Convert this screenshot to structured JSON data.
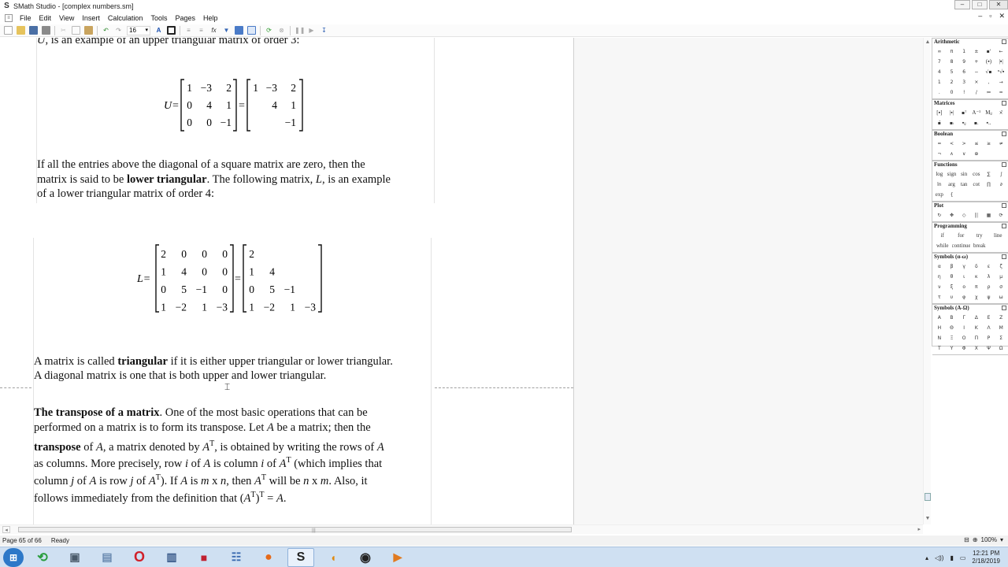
{
  "window": {
    "title": "SMath Studio - [complex numbers.sm]",
    "controls": {
      "minimize": "–",
      "maximize": "□",
      "close": "✕"
    },
    "mdi_controls": {
      "minimize": "–",
      "restore": "▫",
      "close": "✕"
    }
  },
  "menu": [
    "File",
    "Edit",
    "View",
    "Insert",
    "Calculation",
    "Tools",
    "Pages",
    "Help"
  ],
  "toolbar": {
    "font_size": "16"
  },
  "document": {
    "intro_fragment": "is an example of an upper triangular matrix of order 3:",
    "intro_var": "U",
    "upper_label": "U=",
    "upper_full": [
      [
        "1",
        "−3",
        "2"
      ],
      [
        "0",
        "4",
        "1"
      ],
      [
        "0",
        "0",
        "−1"
      ]
    ],
    "upper_short": [
      [
        "1",
        "−3",
        "2"
      ],
      [
        "",
        "4",
        "1"
      ],
      [
        "",
        "",
        "−1"
      ]
    ],
    "para_lower_1a": "If all the entries above the diagonal of a square matrix are zero, then the",
    "para_lower_2a": "matrix is said to be ",
    "para_lower_2b": "lower triangular",
    "para_lower_2c": ". The following matrix, ",
    "para_lower_2d": "L",
    "para_lower_2e": ", is an example",
    "para_lower_3": "of a lower triangular matrix of order 4:",
    "lower_label": "L=",
    "lower_full": [
      [
        "2",
        "0",
        "0",
        "0"
      ],
      [
        "1",
        "4",
        "0",
        "0"
      ],
      [
        "0",
        "5",
        "−1",
        "0"
      ],
      [
        "1",
        "−2",
        "1",
        "−3"
      ]
    ],
    "lower_short": [
      [
        "2",
        "",
        "",
        ""
      ],
      [
        "1",
        "4",
        "",
        ""
      ],
      [
        "0",
        "5",
        "−1",
        ""
      ],
      [
        "1",
        "−2",
        "1",
        "−3"
      ]
    ],
    "tri_1a": "A matrix is called ",
    "tri_1b": "triangular",
    "tri_1c": " if it is either upper triangular or lower triangular.",
    "tri_2": "A diagonal matrix is one that is both upper and lower triangular.",
    "t1a": "The transpose of a matrix",
    "t1b": ". One of the most basic operations that can be",
    "t2a": "performed on a matrix is to form its transpose. Let ",
    "t2b": "A",
    "t2c": " be a matrix; then the",
    "t3a": "transpose",
    "t3b": " of ",
    "t3c": "A",
    "t3d": ", a matrix denoted by ",
    "t3e": "A",
    "t3sup": "T",
    "t3f": ", is obtained by writing the rows of ",
    "t3g": "A",
    "t4a": "as columns. More precisely, row ",
    "t4b": "i",
    "t4c": " of ",
    "t4d": "A",
    "t4e": " is column ",
    "t4f": "i",
    "t4g": " of ",
    "t4h": "A",
    "t4sup": "T",
    "t4i": " (which implies that",
    "t5a": "column ",
    "t5b": "j",
    "t5c": " of ",
    "t5d": "A",
    "t5e": " is row ",
    "t5f": "j",
    "t5g": " of ",
    "t5h": "A",
    "t5sup": "T",
    "t5i": "). If ",
    "t5j": "A",
    "t5k": " is ",
    "t5l": "m",
    "t5m": " x ",
    "t5n": "n",
    "t5o": ", then ",
    "t5p": "A",
    "t5sup2": "T",
    "t5q": " will be ",
    "t5r": "n",
    "t5s": " x ",
    "t5t": "m",
    "t5u": ". Also, it",
    "t6a": "follows immediately from the definition that (",
    "t6b": "A",
    "t6sup": "T",
    "t6c": ")",
    "t6sup2": "T",
    "t6d": " = ",
    "t6e": "A",
    "t6f": "."
  },
  "panels": [
    {
      "title": "Arithmetic",
      "cols": 6,
      "items": [
        "∞",
        "π",
        "1",
        "±",
        "▪'",
        "←",
        "7",
        "8",
        "9",
        "+",
        "(▪)",
        "|▪|",
        "4",
        "5",
        "6",
        "−",
        "√▪",
        "ⁿ√▪",
        "1",
        "2",
        "3",
        "×",
        ",",
        "→",
        ".",
        "0",
        "!",
        "/",
        "≔",
        "="
      ]
    },
    {
      "title": "Matrices",
      "cols": 6,
      "items": [
        "[▪]",
        "|▪|",
        "▪ᵀ",
        "A⁻¹",
        "Mᵢⱼ",
        "×̄",
        "▪̄",
        "▪ᵢ",
        "▪ᵢⱼ",
        "▪.",
        "▪..",
        ""
      ]
    },
    {
      "title": "Boolean",
      "cols": 6,
      "items": [
        "=",
        "<",
        ">",
        "≤",
        "≥",
        "≠",
        "¬",
        "∧",
        "∨",
        "⊕",
        "",
        ""
      ]
    },
    {
      "title": "Functions",
      "cols": 6,
      "items": [
        "log",
        "sign",
        "sin",
        "cos",
        "∑",
        "∫",
        "ln",
        "arg",
        "tan",
        "cot",
        "∏",
        "∂",
        "exp",
        "{",
        "",
        "",
        "",
        ""
      ]
    },
    {
      "title": "Plot",
      "cols": 6,
      "items": [
        "↻",
        "✥",
        "◇",
        "|||",
        "▦",
        "⟳"
      ]
    },
    {
      "title": "Programming",
      "cols": 4,
      "items": [
        "if",
        "for",
        "try",
        "line",
        "while",
        "continue",
        "break",
        ""
      ]
    },
    {
      "title": "Symbols (α-ω)",
      "cols": 6,
      "items": [
        "α",
        "β",
        "γ",
        "δ",
        "ε",
        "ζ",
        "η",
        "θ",
        "ι",
        "κ",
        "λ",
        "μ",
        "ν",
        "ξ",
        "ο",
        "π",
        "ρ",
        "σ",
        "τ",
        "υ",
        "φ",
        "χ",
        "ψ",
        "ω"
      ]
    },
    {
      "title": "Symbols (A-Ω)",
      "cols": 6,
      "items": [
        "Α",
        "Β",
        "Γ",
        "Δ",
        "Ε",
        "Ζ",
        "Η",
        "Θ",
        "Ι",
        "Κ",
        "Λ",
        "Μ",
        "Ν",
        "Ξ",
        "Ο",
        "Π",
        "Ρ",
        "Σ",
        "Τ",
        "Υ",
        "Φ",
        "Χ",
        "Ψ",
        "Ω"
      ]
    }
  ],
  "status": {
    "page": "Page 65 of 66",
    "state": "Ready",
    "zoom": "100%"
  },
  "clock": {
    "time": "12:21 PM",
    "date": "2/18/2019"
  }
}
